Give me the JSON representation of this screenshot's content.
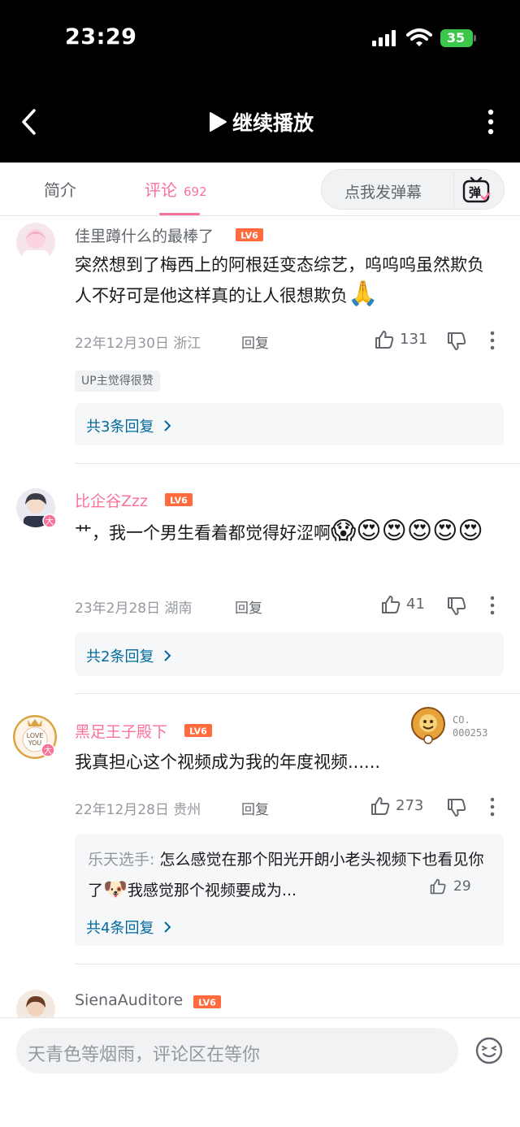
{
  "status": {
    "time": "23:29",
    "battery": "35"
  },
  "header": {
    "back_icon": "chevron-left-icon",
    "play_icon": "play-icon",
    "play_label": "继续播放",
    "more_icon": "more-vertical-icon"
  },
  "tabs": {
    "intro": "简介",
    "comments": "评论",
    "comments_count": "692",
    "danmaku_placeholder": "点我发弹幕",
    "danmaku_icon": "danmaku-icon",
    "accent": "#fb7299"
  },
  "comments": [
    {
      "username": "佳里蹲什么的最棒了",
      "level": "LV6",
      "text": "突然想到了梅西上的阿根廷变态综艺，呜呜呜虽然欺负人不好可是他这样真的让人很想欺负",
      "text_emoji": "🙏",
      "date": "22年12月30日",
      "region": "浙江",
      "reply": "回复",
      "likes": "131",
      "up_tag": "UP主觉得很赞",
      "replies": "共3条回复"
    },
    {
      "username": "比企谷Zzz",
      "level": "LV6",
      "text": "艹，我一个男生看着都觉得好涩啊",
      "text_emoji": "😱😍😍😍😍😍",
      "date": "23年2月28日",
      "region": "湖南",
      "reply": "回复",
      "likes": "41",
      "replies": "共2条回复"
    },
    {
      "username": "黑足王子殿下",
      "level": "LV6",
      "badge_line1": "CO.",
      "badge_line2": "000253",
      "text": "我真担心这个视频成为我的年度视频......",
      "date": "22年12月28日",
      "region": "贵州",
      "reply": "回复",
      "likes": "273",
      "sub_author": "乐天选手",
      "sub_text_a": "怎么感觉在那个阳光开朗小老头视频下也看见你了",
      "sub_emoji": "🐶",
      "sub_text_b": "我感觉那个视频要成为...",
      "sub_likes": "29",
      "replies": "共4条回复"
    },
    {
      "username": "SienaAuditore",
      "level": "LV6"
    }
  ],
  "input": {
    "placeholder": "天青色等烟雨，评论区在等你",
    "emoji_icon": "emoji-face-icon"
  }
}
